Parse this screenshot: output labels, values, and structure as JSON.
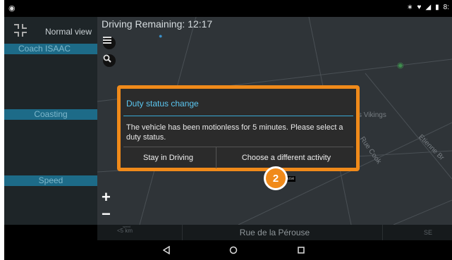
{
  "status_bar": {
    "right_text": "8:",
    "icons": [
      "notification-icon",
      "bluetooth-icon",
      "wifi-icon",
      "signal-icon",
      "battery-icon"
    ]
  },
  "left_panel": {
    "view_label": "Normal view",
    "driver_label": "Coach ISAAC",
    "status_label": "Coasting",
    "speed_label": "Speed"
  },
  "map": {
    "driving_remaining": "Driving Remaining: 12:17",
    "labels": {
      "vikings": "s Vikings",
      "rue_cook": "Rue Cook",
      "etienne": "Etienne Br",
      "road_tag": "a Pérouse"
    },
    "zoom_in": "+",
    "zoom_out": "−"
  },
  "dialog": {
    "title": "Duty status change",
    "message": "The vehicle has been motionless for 5 minutes. Please select a duty status.",
    "stay_button": "Stay in Driving",
    "choose_button": "Choose a different activity"
  },
  "step_badge": "2",
  "info_bar": {
    "left_small": "speed",
    "left_value": "<5 km",
    "street": "Rue de la Pérouse",
    "right_value": "SE"
  },
  "colors": {
    "accent_orange": "#f08a1a",
    "dialog_title_blue": "#5bc6f0",
    "panel_bar_blue": "#1d6b88"
  }
}
